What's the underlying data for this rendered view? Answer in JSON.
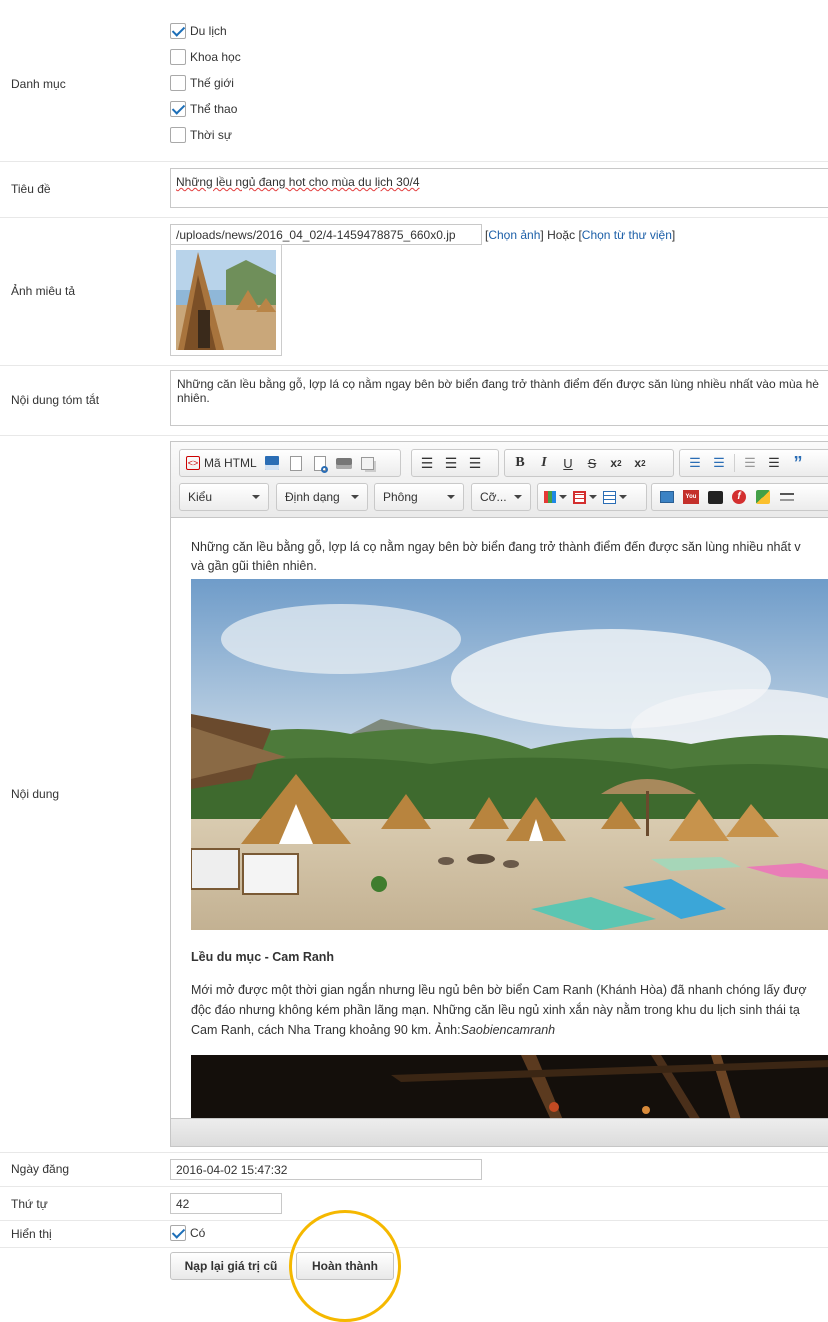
{
  "category": {
    "label": "Danh mục",
    "options": [
      {
        "label": "Du lịch",
        "checked": true
      },
      {
        "label": "Khoa học",
        "checked": false
      },
      {
        "label": "Thế giới",
        "checked": false
      },
      {
        "label": "Thể thao",
        "checked": true
      },
      {
        "label": "Thời sự",
        "checked": false
      }
    ]
  },
  "title": {
    "label": "Tiêu đề",
    "value": "Những lều ngủ đang hot cho mùa du lịch 30/4"
  },
  "image": {
    "label": "Ảnh miêu tả",
    "path": "/uploads/news/2016_04_02/4-1459478875_660x0.jp",
    "choose_label": "Chọn ảnh",
    "or_label": "Hoặc",
    "library_label": "Chọn từ thư viện"
  },
  "summary": {
    "label": "Nội dung tóm tắt",
    "value": "Những căn lều bằng gỗ, lợp lá cọ nằm ngay bên bờ biển đang trở thành điểm đến được săn lùng nhiều nhất vào mùa hè nhiên."
  },
  "content": {
    "label": "Nội dung",
    "toolbar": {
      "source_label": "Mã HTML",
      "style_label": "Kiểu",
      "format_label": "Định dạng",
      "font_label": "Phông",
      "size_label": "Cỡ..."
    },
    "intro": "Những căn lều bằng gỗ, lợp lá cọ nằm ngay bên bờ biển đang trở thành điểm đến được săn lùng nhiều nhất v",
    "intro_line2": "và gần gũi thiên nhiên.",
    "caption": "Lều du mục - Cam Ranh",
    "para_line1": "Mới mở được một thời gian ngắn nhưng lều ngủ bên bờ biển Cam Ranh (Khánh Hòa) đã nhanh chóng lấy đượ",
    "para_line2": "độc đáo nhưng không kém phần lãng mạn. Những căn lều ngủ xinh xắn này nằm trong khu du lịch sinh thái tạ",
    "para_line3": "Cam Ranh, cách Nha Trang khoảng 90 km. Ảnh:",
    "para_credit": "Saobiencamranh"
  },
  "publish_date": {
    "label": "Ngày đăng",
    "value": "2016-04-02 15:47:32"
  },
  "order": {
    "label": "Thứ tự",
    "value": "42"
  },
  "visible": {
    "label": "Hiển thị",
    "option": "Có",
    "checked": true
  },
  "actions": {
    "reset_label": "Nạp lại giá trị cũ",
    "submit_label": "Hoàn thành"
  },
  "colors": {
    "link": "#1c5fa8",
    "check": "#1d6fb8",
    "highlight_circle": "#f5b800"
  }
}
